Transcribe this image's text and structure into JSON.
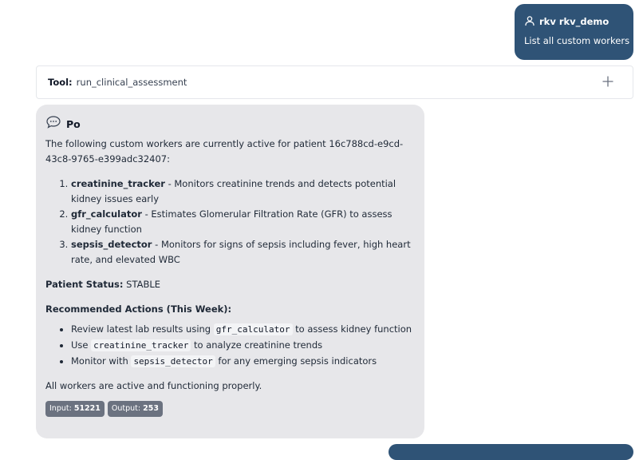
{
  "user_message": {
    "username": "rkv rkv_demo",
    "text": "List all custom workers",
    "icon": "user-icon"
  },
  "tool": {
    "label": "Tool:",
    "name": "run_clinical_assessment",
    "expand_icon": "plus-icon"
  },
  "assistant": {
    "name": "Po",
    "icon": "chat-bubble-icon",
    "intro": "The following custom workers are currently active for patient 16c788cd-e9cd-43c8-9765-e399adc32407:",
    "workers": [
      {
        "name": "creatinine_tracker",
        "desc": " - Monitors creatinine trends and detects potential kidney issues early"
      },
      {
        "name": "gfr_calculator",
        "desc": " - Estimates Glomerular Filtration Rate (GFR) to assess kidney function"
      },
      {
        "name": "sepsis_detector",
        "desc": " - Monitors for signs of sepsis including fever, high heart rate, and elevated WBC"
      }
    ],
    "status_label": "Patient Status:",
    "status_value": " STABLE",
    "actions_title": "Recommended Actions (This Week):",
    "actions": [
      {
        "pre": "Review latest lab results using ",
        "code": "gfr_calculator",
        "post": " to assess kidney function"
      },
      {
        "pre": "Use ",
        "code": "creatinine_tracker",
        "post": " to analyze creatinine trends"
      },
      {
        "pre": "Monitor with ",
        "code": "sepsis_detector",
        "post": " for any emerging sepsis indicators"
      }
    ],
    "closing": "All workers are active and functioning properly.",
    "tokens": {
      "input_label": "Input: ",
      "input_value": "51221",
      "output_label": "Output: ",
      "output_value": "253"
    }
  },
  "colors": {
    "user_bubble": "#2f5376",
    "assistant_bubble": "#e7e7ea",
    "badge": "#6b7280"
  }
}
